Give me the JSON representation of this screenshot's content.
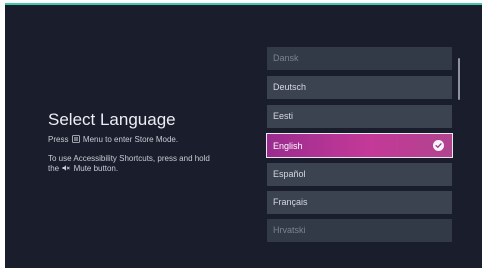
{
  "page": {
    "title": "Select Language",
    "instruction_store_prefix": "Press",
    "instruction_store_suffix": "Menu to enter Store Mode.",
    "instruction_access_part1": "To use Accessibility Shortcuts, press and hold",
    "instruction_access_part2_prefix": "the",
    "instruction_access_part2_suffix": "Mute button."
  },
  "languages": {
    "items": [
      {
        "label": "Dansk"
      },
      {
        "label": "Deutsch"
      },
      {
        "label": "Eesti"
      },
      {
        "label": "English"
      },
      {
        "label": "Español"
      },
      {
        "label": "Français"
      },
      {
        "label": "Hrvatski"
      }
    ],
    "selected": "English"
  },
  "colors": {
    "background": "#1a1d2b",
    "accent_top": "#3ec9a7",
    "item_bg": "#3b4250",
    "selected_start": "#9a2c8f",
    "selected_end": "#c43998"
  },
  "icons": {
    "menu": "menu-button-icon",
    "mute": "mute-icon",
    "check": "checkmark-icon"
  }
}
